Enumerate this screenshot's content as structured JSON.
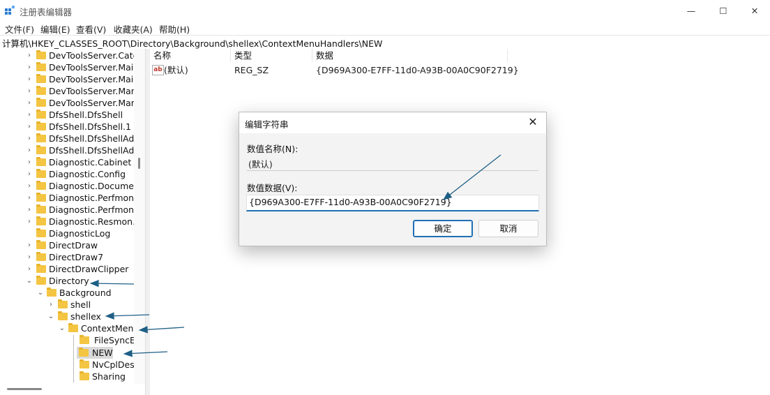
{
  "window": {
    "title": "注册表编辑器",
    "minimize_glyph": "—",
    "maximize_glyph": "☐",
    "close_glyph": "✕"
  },
  "menu": [
    "文件(F)",
    "编辑(E)",
    "查看(V)",
    "收藏夹(A)",
    "帮助(H)"
  ],
  "address": "计算机\\HKEY_CLASSES_ROOT\\Directory\\Background\\shellex\\ContextMenuHandlers\\NEW",
  "tree": [
    {
      "label": "DevToolsServer.Categ",
      "chevron": "›"
    },
    {
      "label": "DevToolsServer.Main",
      "chevron": "›"
    },
    {
      "label": "DevToolsServer.Main",
      "chevron": "›"
    },
    {
      "label": "DevToolsServer.Mana",
      "chevron": "›"
    },
    {
      "label": "DevToolsServer.Mana",
      "chevron": "›"
    },
    {
      "label": "DfsShell.DfsShell",
      "chevron": "›"
    },
    {
      "label": "DfsShell.DfsShell.1",
      "chevron": "›"
    },
    {
      "label": "DfsShell.DfsShellAdmi",
      "chevron": "›"
    },
    {
      "label": "DfsShell.DfsShellAdmi",
      "chevron": "›"
    },
    {
      "label": "Diagnostic.Cabinet",
      "chevron": "›"
    },
    {
      "label": "Diagnostic.Config",
      "chevron": "›"
    },
    {
      "label": "Diagnostic.Document",
      "chevron": "›"
    },
    {
      "label": "Diagnostic.Perfmon.C",
      "chevron": "›"
    },
    {
      "label": "Diagnostic.Perfmon.D",
      "chevron": "›"
    },
    {
      "label": "Diagnostic.Resmon.Co",
      "chevron": "›"
    },
    {
      "label": "DiagnosticLog",
      "chevron": ""
    },
    {
      "label": "DirectDraw",
      "chevron": "›"
    },
    {
      "label": "DirectDraw7",
      "chevron": "›"
    },
    {
      "label": "DirectDrawClipper",
      "chevron": "›"
    },
    {
      "label": "Directory",
      "chevron": "⌄"
    },
    {
      "label": "Background",
      "chevron": "⌄"
    },
    {
      "label": "shell",
      "chevron": "›"
    },
    {
      "label": "shellex",
      "chevron": "⌄"
    },
    {
      "label": "ContextMenu",
      "chevron": "⌄"
    },
    {
      "label": "FileSyncEx",
      "chevron": ""
    },
    {
      "label": "NEW",
      "chevron": ""
    },
    {
      "label": "NvCplDesk",
      "chevron": ""
    },
    {
      "label": "Sharing",
      "chevron": ""
    }
  ],
  "list": {
    "headers": [
      "名称",
      "类型",
      "数据"
    ],
    "rows": [
      {
        "name": "(默认)",
        "type": "REG_SZ",
        "data": "{D969A300-E7FF-11d0-A93B-00A0C90F2719}",
        "icon": "string-value-icon"
      }
    ]
  },
  "dialog": {
    "title": "编辑字符串",
    "name_label": "数值名称(N):",
    "name_value": "(默认)",
    "data_label": "数值数据(V):",
    "data_value": "{D969A300-E7FF-11d0-A93B-00A0C90F2719}",
    "ok": "确定",
    "cancel": "取消",
    "close_glyph": "✕"
  },
  "colors": {
    "accent": "#1f6fb5",
    "annotation_arrow": "#1f5f86",
    "folder": "#f4c542",
    "selection": "#cce8ff"
  }
}
